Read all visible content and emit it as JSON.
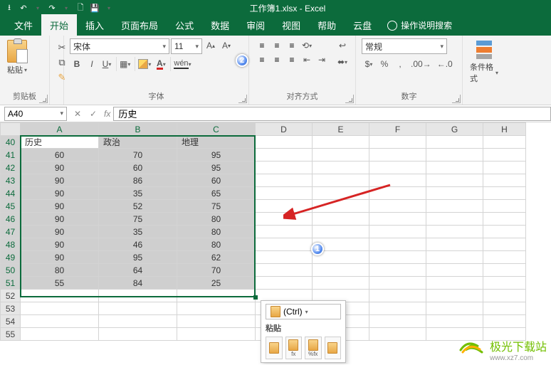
{
  "titlebar": {
    "title": "工作簿1.xlsx - Excel"
  },
  "tabs": {
    "file": "文件",
    "home": "开始",
    "insert": "插入",
    "layout": "页面布局",
    "formulas": "公式",
    "data": "数据",
    "review": "审阅",
    "view": "视图",
    "help": "帮助",
    "yunpan": "云盘",
    "tellme": "操作说明搜索"
  },
  "ribbon": {
    "clipboard": {
      "paste": "粘贴",
      "group": "剪贴板"
    },
    "font": {
      "family": "宋体",
      "size": "11",
      "group": "字体",
      "bold": "B",
      "italic": "I",
      "underline": "U",
      "wen": "wén"
    },
    "alignment": {
      "group": "对齐方式"
    },
    "number": {
      "format": "常规",
      "group": "数字"
    },
    "styles": {
      "condfmt": "条件格式"
    }
  },
  "namebox": "A40",
  "formula": "历史",
  "grid": {
    "cols": [
      "A",
      "B",
      "C",
      "D",
      "E",
      "F",
      "G",
      "H"
    ],
    "row_start": 40,
    "row_end": 55,
    "headers": [
      "历史",
      "政治",
      "地理"
    ],
    "rows": [
      [
        60,
        70,
        95
      ],
      [
        90,
        60,
        95
      ],
      [
        90,
        86,
        60
      ],
      [
        90,
        35,
        65
      ],
      [
        90,
        52,
        75
      ],
      [
        90,
        75,
        80
      ],
      [
        90,
        35,
        80
      ],
      [
        90,
        46,
        80
      ],
      [
        90,
        95,
        62
      ],
      [
        80,
        64,
        70
      ],
      [
        55,
        84,
        25
      ]
    ]
  },
  "paste_popup": {
    "btn": "(Ctrl)",
    "label": "粘贴"
  },
  "watermark": {
    "name": "极光下载站",
    "url": "www.xz7.com"
  },
  "chart_data": {
    "type": "table",
    "title": "",
    "columns": [
      "历史",
      "政治",
      "地理"
    ],
    "rows": [
      [
        60,
        70,
        95
      ],
      [
        90,
        60,
        95
      ],
      [
        90,
        86,
        60
      ],
      [
        90,
        35,
        65
      ],
      [
        90,
        52,
        75
      ],
      [
        90,
        75,
        80
      ],
      [
        90,
        35,
        80
      ],
      [
        90,
        46,
        80
      ],
      [
        90,
        95,
        62
      ],
      [
        80,
        64,
        70
      ],
      [
        55,
        84,
        25
      ]
    ]
  }
}
